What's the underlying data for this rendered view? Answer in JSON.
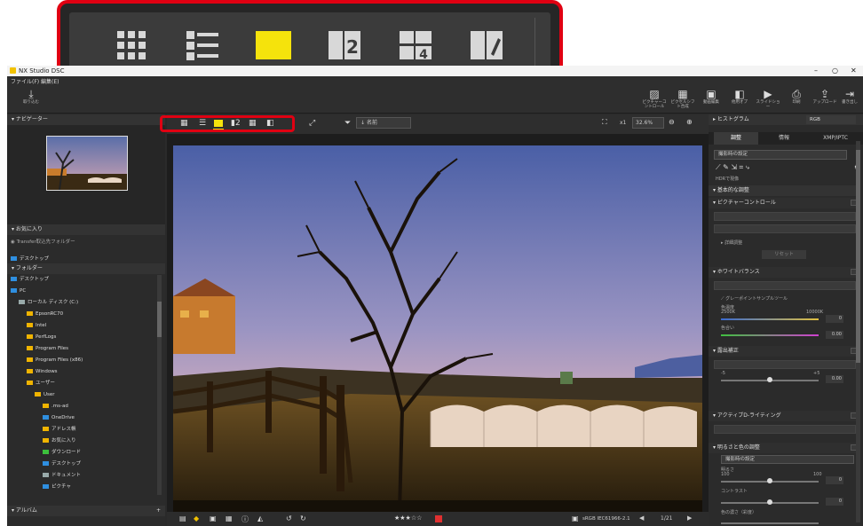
{
  "app": {
    "title": "NX Studio DSC",
    "window_controls": {
      "minimize": "–",
      "maximize": "○",
      "close": "✕"
    }
  },
  "menu": {
    "file": "ファイル(F)",
    "edit": "編集(E)"
  },
  "toolbar": {
    "import_label": "取り込む",
    "items": [
      {
        "label": "ピクチャーコントロール",
        "icon": "picture-control-icon"
      },
      {
        "label": "ピクセルシフト合成",
        "icon": "pixel-shift-icon"
      },
      {
        "label": "動画編集",
        "icon": "movie-edit-icon"
      },
      {
        "label": "他用オプ",
        "icon": "options-icon"
      },
      {
        "label": "スライドショー",
        "icon": "slideshow-icon"
      },
      {
        "label": "印刷",
        "icon": "print-icon"
      },
      {
        "label": "アップロード",
        "icon": "upload-icon"
      },
      {
        "label": "書き出し",
        "icon": "export-icon"
      }
    ]
  },
  "navigator": {
    "title": "ナビゲーター"
  },
  "favorites": {
    "title": "お気に入り",
    "items": [
      "Transfer取込先フォルダー",
      "デスクトップ"
    ]
  },
  "folders": {
    "title": "フォルダー",
    "items": [
      {
        "label": "デスクトップ",
        "depth": 0,
        "color": "blue"
      },
      {
        "label": "PC",
        "depth": 0,
        "color": "blue"
      },
      {
        "label": "ローカル ディスク (C:)",
        "depth": 1,
        "color": "gray"
      },
      {
        "label": "EpsonRC70",
        "depth": 2,
        "color": "yellow"
      },
      {
        "label": "Intel",
        "depth": 2,
        "color": "yellow"
      },
      {
        "label": "PerfLogs",
        "depth": 2,
        "color": "yellow"
      },
      {
        "label": "Program Files",
        "depth": 2,
        "color": "yellow"
      },
      {
        "label": "Program Files (x86)",
        "depth": 2,
        "color": "yellow"
      },
      {
        "label": "Windows",
        "depth": 2,
        "color": "yellow"
      },
      {
        "label": "ユーザー",
        "depth": 2,
        "color": "yellow"
      },
      {
        "label": "User",
        "depth": 3,
        "color": "yellow"
      },
      {
        "label": ".ms-ad",
        "depth": 4,
        "color": "yellow"
      },
      {
        "label": "OneDrive",
        "depth": 4,
        "color": "blue"
      },
      {
        "label": "アドレス帳",
        "depth": 4,
        "color": "yellow"
      },
      {
        "label": "お気に入り",
        "depth": 4,
        "color": "yellow"
      },
      {
        "label": "ダウンロード",
        "depth": 4,
        "color": "green"
      },
      {
        "label": "デスクトップ",
        "depth": 4,
        "color": "blue"
      },
      {
        "label": "ドキュメント",
        "depth": 4,
        "color": "gray"
      },
      {
        "label": "ピクチャ",
        "depth": 4,
        "color": "blue"
      }
    ]
  },
  "albums": {
    "title": "アルバム",
    "add": "+"
  },
  "viewer_toolbar": {
    "filter_label": "名前",
    "zoom_x1": "x1",
    "zoom_percent": "32.6%"
  },
  "status": {
    "color_profile": "sRGB IEC61966-2.1",
    "page": "1/21",
    "rating_stars": 3
  },
  "right": {
    "histogram_title": "ヒストグラム",
    "histogram_mode": "RGB",
    "tabs": [
      "調整",
      "情報",
      "XMP/IPTC"
    ],
    "preset": "撮影時の設定",
    "hdr_check": "HDRで現像",
    "basic_title": "基本的な調整",
    "picture_control": "ピクチャーコントロール",
    "detail_label": "詳細調整",
    "reset": "リセット",
    "white_balance": "ホワイトバランス",
    "gray_point": "グレーポイントサンプルツール",
    "color_temp": "色温度",
    "wb_values": {
      "min": "2500K",
      "max": "10000K",
      "tint": "色合い",
      "val": "0",
      "val2": "0.00"
    },
    "exposure": "露出補正",
    "exposure_values": {
      "min": "-5",
      "max": "+5",
      "val": "0.00"
    },
    "adl": "アクティブD-ライティング",
    "brightness_title": "明るさと色の調整",
    "brightness_preset": "撮影時の設定",
    "brightness": "明るさ",
    "contrast": "コントラスト",
    "saturation": "色の濃さ（彩度）",
    "range_min": "100",
    "range_max": "100",
    "val": "0"
  }
}
